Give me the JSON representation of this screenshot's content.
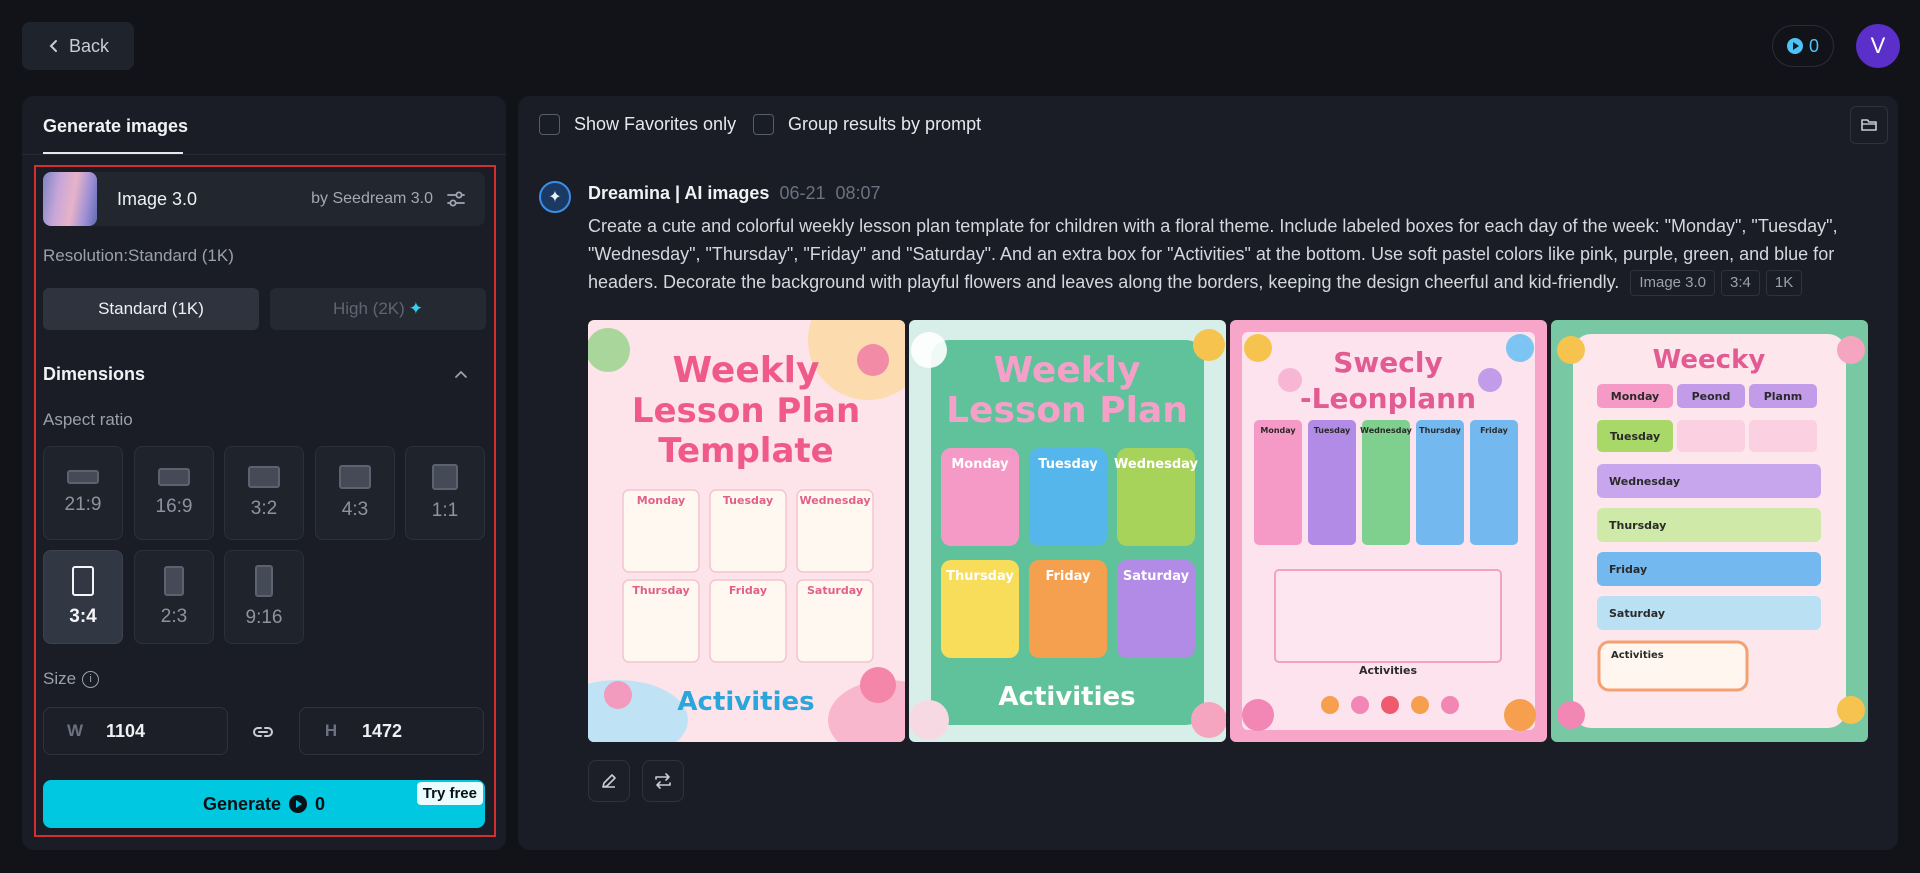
{
  "topbar": {
    "back_label": "Back",
    "credits": "0",
    "avatar_letter": "V"
  },
  "left_panel": {
    "tab_label": "Generate images",
    "model": {
      "name": "Image 3.0",
      "by": "by Seedream 3.0"
    },
    "resolution_label": "Resolution:Standard (1K)",
    "resolution_options": [
      "Standard (1K)",
      "High (2K)"
    ],
    "selected_resolution": "Standard (1K)",
    "dimensions_title": "Dimensions",
    "aspect_ratio_label": "Aspect ratio",
    "aspect_ratios": [
      "21:9",
      "16:9",
      "3:2",
      "4:3",
      "1:1",
      "3:4",
      "2:3",
      "9:16"
    ],
    "selected_aspect_ratio": "3:4",
    "size_label": "Size",
    "width_label": "W",
    "width_value": "1104",
    "height_label": "H",
    "height_value": "1472",
    "generate_label": "Generate",
    "generate_cost": "0",
    "try_free_label": "Try free"
  },
  "right_panel": {
    "show_favorites_label": "Show Favorites only",
    "group_results_label": "Group results by prompt",
    "message": {
      "author": "Dreamina | AI images",
      "date": "06-21",
      "time": "08:07",
      "prompt": "Create a cute and colorful weekly lesson plan template for children with a floral theme. Include labeled boxes for each day of the week: \"Monday\", \"Tuesday\", \"Wednesday\", \"Thursday\", \"Friday\" and \"Saturday\". And an extra box for \"Activities\" at the bottom. Use soft pastel colors like pink, purple, green, and blue for headers. Decorate the background with playful flowers and leaves along the borders, keeping the design cheerful and kid-friendly.",
      "tags": [
        "Image 3.0",
        "3:4",
        "1K"
      ]
    },
    "images": [
      {
        "title_lines": [
          "Weekly",
          "Lesson Plan",
          "Template"
        ],
        "days": [
          "Monday",
          "Tuesday",
          "Wednesday",
          "Thursday",
          "Friday",
          "Saturday"
        ],
        "footer": "Activities"
      },
      {
        "title_lines": [
          "Weekly",
          "Lesson Plan"
        ],
        "days": [
          "Monday",
          "Tuesday",
          "Wednesday",
          "Thursday",
          "Friday",
          "Saturday"
        ],
        "footer": "Activities"
      },
      {
        "title_lines": [
          "Swecly",
          "-Leonplann"
        ],
        "days": [
          "Monday",
          "Tuesday",
          "Wednesday",
          "Thursday",
          "Friday"
        ],
        "footer": "Activities"
      },
      {
        "title_lines": [
          "Weecky"
        ],
        "days": [
          "Monday",
          "Peond",
          "Planm",
          "Tuesday",
          "Wednesday",
          "Thursday",
          "Friday",
          "Saturday"
        ],
        "footer": "Activities"
      }
    ]
  },
  "colors": {
    "accent": "#00c8e0",
    "highlight_border": "#d32f2f",
    "avatar_bg": "#5b2fc9"
  }
}
